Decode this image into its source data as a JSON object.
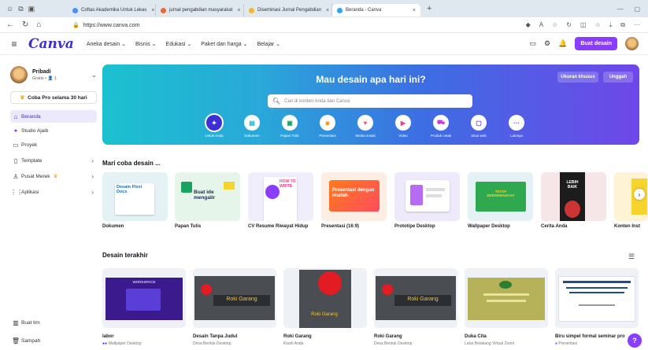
{
  "browser": {
    "tabs": [
      {
        "label": "Coftas Akademika Untuk Lekas",
        "color": "#4d8ef7"
      },
      {
        "label": "jurnal pengabdian masyarakat",
        "color": "#e86a3a"
      },
      {
        "label": "Diseminasi Jurnal Pengabdian",
        "color": "#f2b632"
      },
      {
        "label": "Beranda - Canva",
        "color": "#2da6e8"
      }
    ],
    "new_tab": "+",
    "url": "https://www.canva.com"
  },
  "header": {
    "logo": "Canva",
    "nav": [
      "Aneka desain ⌄",
      "Bisnis ⌄",
      "Edukasi ⌄",
      "Paket dan harga ⌄",
      "Belajar ⌄"
    ],
    "create_button": "Buat desain"
  },
  "sidebar": {
    "account_name": "Pribadi",
    "account_sub": "Gratis • 👤 1",
    "pro_label": "Coba Pro selama 30 hari",
    "items": [
      {
        "label": "Beranda",
        "icon": "home-icon",
        "glyph": "⌂"
      },
      {
        "label": "Studio Ajaib",
        "icon": "sparkle-icon",
        "glyph": "✦"
      },
      {
        "label": "Proyek",
        "icon": "folder-icon",
        "glyph": "▭"
      },
      {
        "label": "Template",
        "icon": "template-icon",
        "glyph": "▯"
      },
      {
        "label": "Pusat Merek",
        "icon": "brand-icon",
        "glyph": "♙"
      },
      {
        "label": "Aplikasi",
        "icon": "apps-icon",
        "glyph": "⋮⋮"
      }
    ],
    "bottom": [
      {
        "label": "Buat tim",
        "glyph": "▥"
      },
      {
        "label": "Sampah",
        "glyph": "🗑"
      }
    ]
  },
  "hero": {
    "title": "Mau desain apa hari ini?",
    "search_placeholder": "Cari di konten Anda dan Canva",
    "custom_size": "Ukuran khusus",
    "upload": "Unggah",
    "categories": [
      {
        "label": "Untuk Anda",
        "color": "#3b2fd5",
        "glyph": "✦"
      },
      {
        "label": "Dokumen",
        "color": "#12b5cb",
        "glyph": "▤"
      },
      {
        "label": "Papan Tulis",
        "color": "#1aa260",
        "glyph": "▣"
      },
      {
        "label": "Presentasi",
        "color": "#ff8a00",
        "glyph": "◙"
      },
      {
        "label": "Media sosial",
        "color": "#ff4d5e",
        "glyph": "♥"
      },
      {
        "label": "Video",
        "color": "#e83e8c",
        "glyph": "▶"
      },
      {
        "label": "Produk cetak",
        "color": "#c935d6",
        "glyph": "⛟"
      },
      {
        "label": "Situs web",
        "color": "#4d4df0",
        "glyph": "▢"
      },
      {
        "label": "Lainnya",
        "color": "#6b4de6",
        "glyph": "···"
      }
    ]
  },
  "try_section": {
    "title": "Mari coba desain ...",
    "cards": [
      {
        "label": "Dokumen",
        "thumb_text": "Desain Flexi Docs"
      },
      {
        "label": "Papan Tulis",
        "thumb_text": "Buat ide mengalir"
      },
      {
        "label": "CV Resume Riwayat Hidup",
        "thumb_text": "HOW TO WRITE"
      },
      {
        "label": "Presentasi (16:9)",
        "thumb_text": "Presentasi dengan mudah"
      },
      {
        "label": "Prototipe Desktop",
        "thumb_text": ""
      },
      {
        "label": "Wallpaper Desktop",
        "thumb_text": "TETAP BERSEMANGAT"
      },
      {
        "label": "Cerita Anda",
        "thumb_text": "LEBIH BAIK"
      },
      {
        "label": "Konten Inst",
        "thumb_text": ""
      }
    ]
  },
  "recent_section": {
    "title": "Desain terakhir",
    "items": [
      {
        "name": "labor",
        "type": "Wallpaper Desktop",
        "thumb_text": "WORKSPACE"
      },
      {
        "name": "Desain Tanpa Judul",
        "type": "Desa Bentuk Desktop",
        "thumb_text": "Roki Garang"
      },
      {
        "name": "Roki Garang",
        "type": "Kisah Anda",
        "thumb_text": "Roki Garang"
      },
      {
        "name": "Roki Garang",
        "type": "Desa Bentuk Desktop",
        "thumb_text": "Roki Garang"
      },
      {
        "name": "Duka Cita",
        "type": "Latar Belakang Virtual Zoom",
        "thumb_text": ""
      },
      {
        "name": "Biru simpel formal seminar pro",
        "type": "Presentasi",
        "thumb_text": ""
      }
    ]
  },
  "help": "?"
}
